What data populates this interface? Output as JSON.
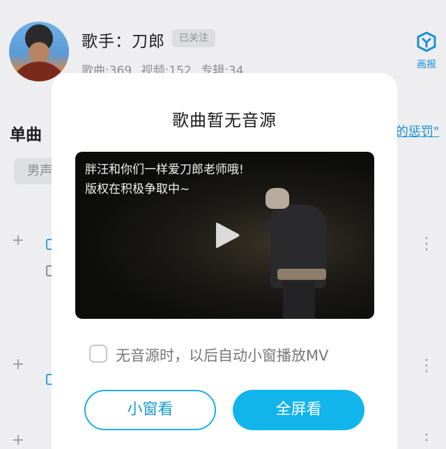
{
  "header": {
    "singer_name": "歌手：刀郎",
    "follow_status": "已关注",
    "stats": {
      "songs": "歌曲:369",
      "videos": "视频:152",
      "albums": "专辑:34"
    },
    "report_label": "画报"
  },
  "content": {
    "section_title": "单曲",
    "right_link_peek": "的惩罚\"",
    "filter_chip_peek": "男声"
  },
  "dialog": {
    "title": "歌曲暂无音源",
    "video_caption": [
      "胖汪和你们一样爱刀郎老师哦!",
      "版权在积极争取中~"
    ],
    "checkbox_label": "无音源时，以后自动小窗播放MV",
    "small_window_button": "小窗看",
    "fullscreen_button": "全屏看"
  },
  "colors": {
    "accent": "#12b4ec",
    "link": "#1a8fd6",
    "dialog_bg": "#ffffff",
    "page_bg": "#eeeef1"
  },
  "icons": [
    "report-icon",
    "play-icon",
    "plus-icon",
    "more-icon",
    "checkbox-icon"
  ]
}
